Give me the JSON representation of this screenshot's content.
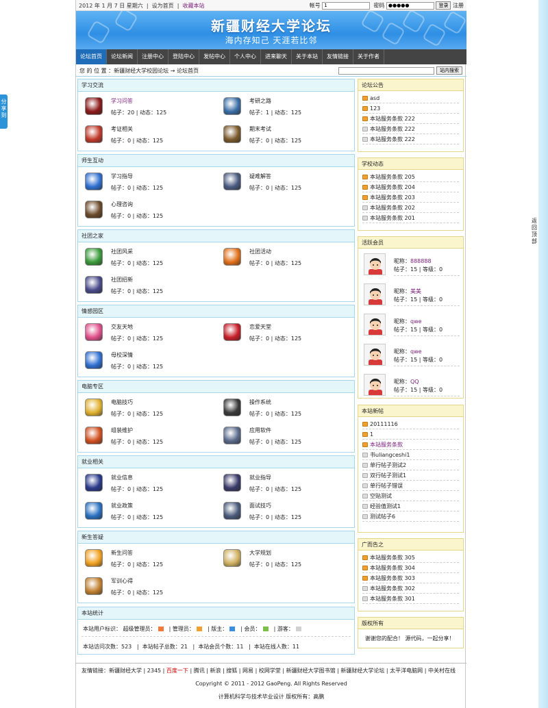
{
  "topbar": {
    "date": "2012 年 1 月 7 日 星期六",
    "set_home": "设为首页",
    "favorite": "收藏本站",
    "account_label": "帐号",
    "account_value": "1",
    "password_label": "密码",
    "password_value": "●●●●●",
    "login_button": "登录",
    "register": "注册"
  },
  "banner": {
    "title": "新疆财经大学论坛",
    "subtitle": "海内存知己  天涯若比邻"
  },
  "nav": [
    "论坛首页",
    "论坛新闻",
    "注册中心",
    "登陆中心",
    "发帖中心",
    "个人中心",
    "进来聊天",
    "关于本站",
    "友情链接",
    "关于作者"
  ],
  "location": {
    "text": "您 的 位 置 ：新疆财经大学校园论坛  →  论坛首页",
    "search_button": "站内搜索",
    "search_value": ""
  },
  "sections": [
    {
      "title": "学习交流",
      "forums": [
        {
          "name": "学习问答",
          "stat": "帖子：20 | 动态：125",
          "highlight": true
        },
        {
          "name": "考研之路",
          "stat": "帖子：1 | 动态：125"
        },
        {
          "name": "考证相关",
          "stat": "帖子：0 | 动态：125"
        },
        {
          "name": "期末考试",
          "stat": "帖子：0 | 动态：125"
        }
      ]
    },
    {
      "title": "师生互动",
      "forums": [
        {
          "name": "学习指导",
          "stat": "帖子：0 | 动态：125"
        },
        {
          "name": "疑难解答",
          "stat": "帖子：0 | 动态：125"
        },
        {
          "name": "心理咨询",
          "stat": "帖子：0 | 动态：125"
        }
      ]
    },
    {
      "title": "社团之家",
      "forums": [
        {
          "name": "社团风采",
          "stat": "帖子：0 | 动态：125"
        },
        {
          "name": "社团活动",
          "stat": "帖子：0 | 动态：125"
        },
        {
          "name": "社团招新",
          "stat": "帖子：0 | 动态：125"
        }
      ]
    },
    {
      "title": "情感园区",
      "forums": [
        {
          "name": "交友天地",
          "stat": "帖子：0 | 动态：125"
        },
        {
          "name": "恋爱天堂",
          "stat": "帖子：0 | 动态：125"
        },
        {
          "name": "母校深情",
          "stat": "帖子：0 | 动态：125"
        }
      ]
    },
    {
      "title": "电脑专区",
      "forums": [
        {
          "name": "电脑技巧",
          "stat": "帖子：0 | 动态：125"
        },
        {
          "name": "操作系统",
          "stat": "帖子：0 | 动态：125"
        },
        {
          "name": "组装维护",
          "stat": "帖子：0 | 动态：125"
        },
        {
          "name": "应用软件",
          "stat": "帖子：0 | 动态：125"
        }
      ]
    },
    {
      "title": "就业相关",
      "forums": [
        {
          "name": "就业信息",
          "stat": "帖子：0 | 动态：125"
        },
        {
          "name": "就业指导",
          "stat": "帖子：0 | 动态：125"
        },
        {
          "name": "就业政策",
          "stat": "帖子：0 | 动态：125"
        },
        {
          "name": "面试技巧",
          "stat": "帖子：0 | 动态：125"
        }
      ]
    },
    {
      "title": "新生答疑",
      "forums": [
        {
          "name": "新生问答",
          "stat": "帖子：0 | 动态：125"
        },
        {
          "name": "大学规划",
          "stat": "帖子：0 | 动态：125"
        },
        {
          "name": "军训心得",
          "stat": "帖子：0 | 动态：125"
        }
      ]
    }
  ],
  "site_stats": {
    "title": "本站统计",
    "legend_label": "本站用户标识：",
    "roles": [
      "超级管理员：",
      "管理员：",
      "版主：",
      "会员：",
      "游客："
    ],
    "visits": "本站访问次数：523",
    "posts": "本站帖子总数：21",
    "members": "本站会员个数：11",
    "online": "本站在线人数：11"
  },
  "notice": {
    "title": "论坛公告",
    "items": [
      "asd",
      "123",
      "本站服务条款 222",
      "本站服务条款 222",
      "本站服务条款 222"
    ]
  },
  "school": {
    "title": "学校动态",
    "items": [
      "本站服务条款 205",
      "本站服务条款 204",
      "本站服务条款 203",
      "本站服务条款 202",
      "本站服务条款 201"
    ]
  },
  "members": {
    "title": "活跃会员",
    "items": [
      {
        "label": "昵称：",
        "nick": "888888",
        "stat": "帖子：15 | 等级：0"
      },
      {
        "label": "昵称：",
        "nick": "美美",
        "stat": "帖子：15 | 等级：0"
      },
      {
        "label": "昵称：",
        "nick": "qwe",
        "stat": "帖子：15 | 等级：0"
      },
      {
        "label": "昵称：",
        "nick": "qwe",
        "stat": "帖子：15 | 等级：0"
      },
      {
        "label": "昵称：",
        "nick": "QQ",
        "stat": "帖子：15 | 等级：0"
      }
    ]
  },
  "new_posts": {
    "title": "本站新帖",
    "items": [
      "20111116",
      "1",
      "本站服务条款",
      "书uliangceshi1",
      "单行帖子测试2",
      "双行帖子测试1",
      "单行帖子错误",
      "空贴测试",
      "经验值测试1",
      "测试帖子6"
    ]
  },
  "ads": {
    "title": "广而告之",
    "items": [
      "本站服务条款 305",
      "本站服务条款 304",
      "本站服务条款 303",
      "本站服务条款 302",
      "本站服务条款 301"
    ]
  },
  "copyright_box": {
    "title": "版权所有",
    "text": "谢谢您的配合！  源代码，一起分享！"
  },
  "footer": {
    "links_label": "友情链接：",
    "links": [
      "新疆财经大学",
      "2345",
      "百度一下",
      "腾讯",
      "新浪",
      "搜狐",
      "网易",
      "校网学堂",
      "新疆财经大学图书馆",
      "新疆财经大学论坛",
      "太平洋电脑网",
      "中关村在线"
    ],
    "copyright": "Copyright © 2011 - 2012 GaoPeng. All Rights Reserved",
    "credit": "计算机科学与技术毕业设计  版权所有：高鹏"
  },
  "share": "分享到",
  "back_top": "返回顶部",
  "colors": {
    "accent": "#1f6db9",
    "nav_bg": "#444444",
    "box_border": "#a6d6ea",
    "right_header": "#fbf5cd",
    "link_purple": "#7a1a7a"
  }
}
